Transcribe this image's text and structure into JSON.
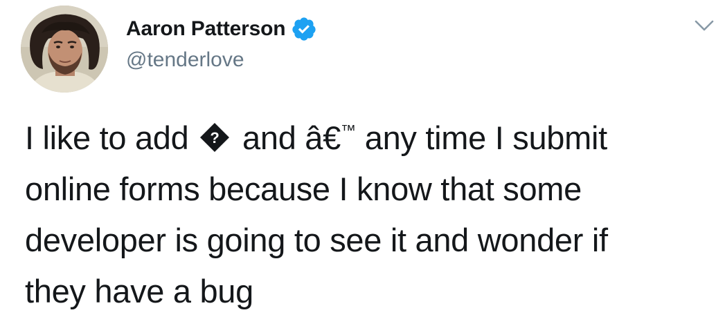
{
  "tweet": {
    "display_name": "Aaron Patterson",
    "handle": "@tenderlove",
    "verified": true,
    "text_lines": {
      "line1_before": "I like to add",
      "replacement_char": "?",
      "line1_mid": "and â€",
      "line1_tm": "™",
      "line1_after": "any time I submit",
      "line2": "online forms because I know that some",
      "line3": "developer is going to see it and wonder if",
      "line4": "they have a bug"
    }
  },
  "icons": {
    "verified_badge": "verified-check-icon",
    "caret": "chevron-down-icon",
    "replacement": "unicode-replacement-character-icon"
  },
  "colors": {
    "text": "#14171a",
    "secondary": "#657786",
    "verified_blue": "#1da1f2",
    "caret": "#8899a6"
  }
}
